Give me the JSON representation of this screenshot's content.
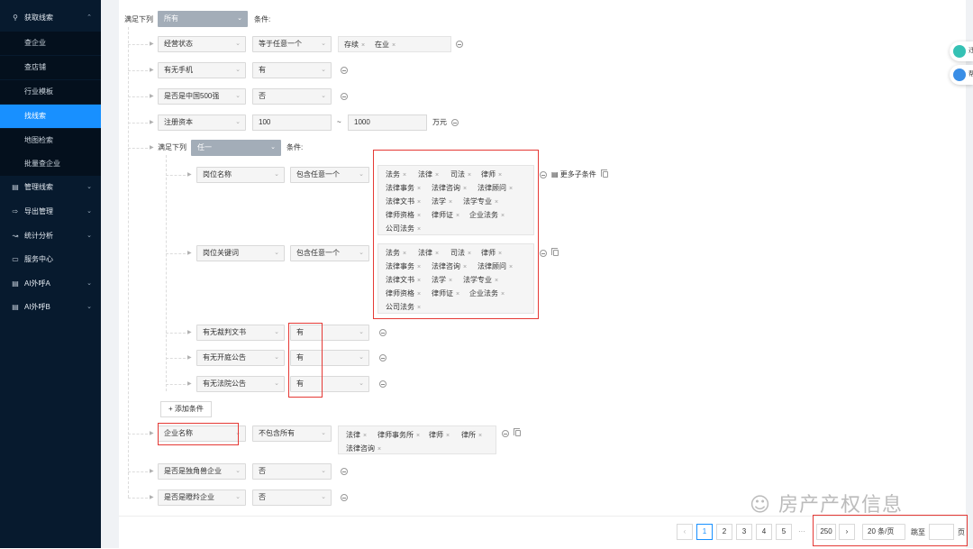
{
  "sidebar": {
    "items": [
      {
        "label": "获取线索",
        "icon": "search-icon"
      },
      {
        "label": "管理线索",
        "icon": "document-icon"
      },
      {
        "label": "导出管理",
        "icon": "export-icon"
      },
      {
        "label": "统计分析",
        "icon": "chart-icon"
      },
      {
        "label": "服务中心",
        "icon": "service-icon"
      },
      {
        "label": "AI外呼A",
        "icon": "phone-icon"
      },
      {
        "label": "AI外呼B",
        "icon": "phone-icon"
      }
    ],
    "subitems": [
      "查企业",
      "查店铺",
      "行业模板",
      "找线索",
      "地图检索",
      "批量查企业"
    ]
  },
  "filter": {
    "top_label": "满足下列",
    "top_mode": "所有",
    "top_suffix": "条件:",
    "r1": {
      "field": "经营状态",
      "op": "等于任意一个",
      "tags": [
        "存续",
        "在业"
      ]
    },
    "r2": {
      "field": "有无手机",
      "value": "有"
    },
    "r3": {
      "field": "是否是中国500强",
      "value": "否"
    },
    "r4": {
      "field": "注册资本",
      "min": "100",
      "tilde": "~",
      "max": "1000",
      "unit": "万元"
    },
    "group": {
      "label": "满足下列",
      "mode": "任一",
      "suffix": "条件:"
    },
    "g1": {
      "field": "岗位名称",
      "op": "包含任意一个",
      "more": "更多子条件",
      "tags": [
        "法务",
        "法律",
        "司法",
        "律师",
        "法律事务",
        "法律咨询",
        "法律顾问",
        "法律文书",
        "法学",
        "法学专业",
        "律师资格",
        "律师证",
        "企业法务",
        "公司法务"
      ]
    },
    "g2": {
      "field": "岗位关键词",
      "op": "包含任意一个",
      "tags": [
        "法务",
        "法律",
        "司法",
        "律师",
        "法律事务",
        "法律咨询",
        "法律顾问",
        "法律文书",
        "法学",
        "法学专业",
        "律师资格",
        "律师证",
        "企业法务",
        "公司法务"
      ]
    },
    "g3": {
      "field": "有无裁判文书",
      "value": "有"
    },
    "g4": {
      "field": "有无开庭公告",
      "value": "有"
    },
    "g5": {
      "field": "有无法院公告",
      "value": "有"
    },
    "add_label": "添加条件",
    "r5": {
      "field": "企业名称",
      "op": "不包含所有",
      "tags": [
        "法律",
        "律师事务所",
        "律师",
        "律所",
        "法律咨询"
      ]
    },
    "r6": {
      "field": "是否是独角兽企业",
      "value": "否"
    },
    "r7": {
      "field": "是否是瞪羚企业",
      "value": "否"
    }
  },
  "pager": {
    "pages": [
      "1",
      "2",
      "3",
      "4",
      "5"
    ],
    "ellipsis": "···",
    "last": "250",
    "page_size": "20 条/页",
    "jump_label": "跳至",
    "page_suffix": "页"
  },
  "float": {
    "f1": "迁",
    "f2": "帮"
  },
  "watermark": "房产产权信息"
}
